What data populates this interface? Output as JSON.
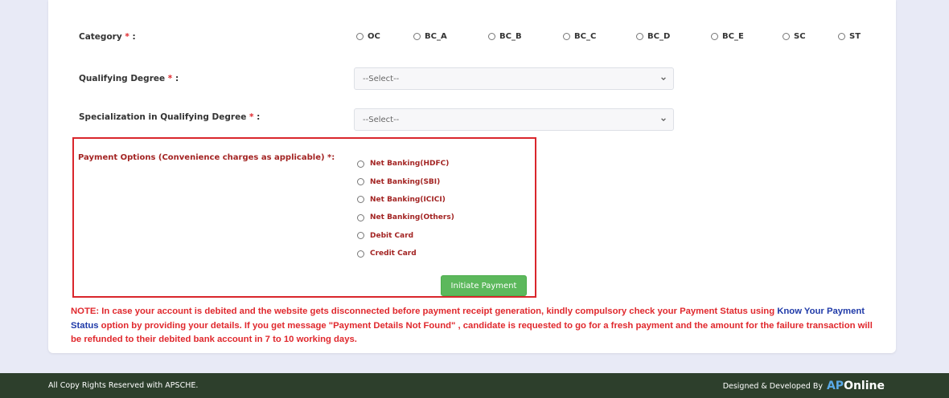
{
  "form": {
    "category": {
      "label": "Category",
      "required_mark": "*",
      "label_suffix": ":",
      "options": [
        "OC",
        "BC_A",
        "BC_B",
        "BC_C",
        "BC_D",
        "BC_E",
        "SC",
        "ST"
      ]
    },
    "qualifying_degree": {
      "label": "Qualifying Degree",
      "required_mark": "*",
      "label_suffix": ":",
      "selected": "--Select--"
    },
    "specialization": {
      "label": "Specialization in Qualifying Degree",
      "required_mark": "*",
      "label_suffix": ":",
      "selected": "--Select--"
    },
    "payment": {
      "label": "Payment Options (Convenience charges as applicable) *:",
      "options": [
        "Net Banking(HDFC)",
        "Net Banking(SBI)",
        "Net Banking(ICICI)",
        "Net Banking(Others)",
        "Debit Card",
        "Credit Card"
      ],
      "button_label": "Initiate Payment"
    }
  },
  "note": {
    "part1": "NOTE: In case your account is debited and the website gets disconnected before payment receipt generation, kindly compulsory check your Payment Status using ",
    "link": "Know Your Payment Status",
    "part2": " option by providing your details. If you get message \"Payment Details Not Found\" , candidate is requested to go for a fresh payment and the amount for the failure transaction will be refunded to their debited bank account in 7 to 10 working days."
  },
  "footer": {
    "copyright": "All Copy Rights Reserved with APSCHE.",
    "credit": "Designed & Developed By",
    "logo_ap": "AP",
    "logo_online": "Online"
  },
  "colors": {
    "required": "#e0282d",
    "payment_text": "#a32423",
    "highlight_border": "#d9262c",
    "button": "#5cb85c",
    "link": "#1f3aa8",
    "footer_bg": "#2d3f2c",
    "page_bg": "#e8eaf6"
  }
}
